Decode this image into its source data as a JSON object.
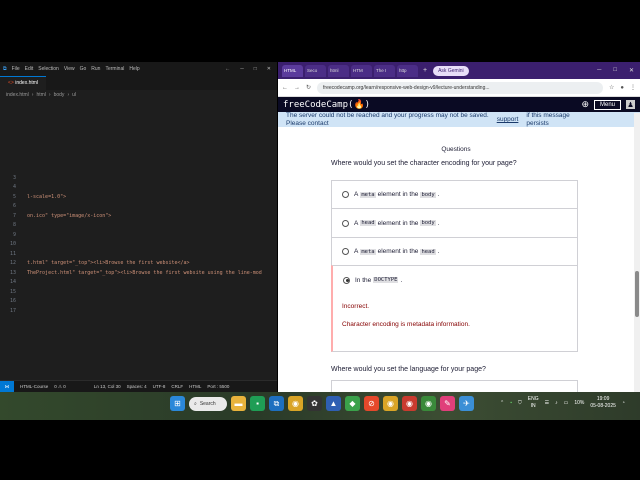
{
  "vscode": {
    "menu": [
      "File",
      "Edit",
      "Selection",
      "View",
      "Go",
      "Run",
      "Terminal",
      "Help"
    ],
    "tab": "index.html",
    "breadcrumb": [
      "index.html",
      "html",
      "body",
      "ul"
    ],
    "lines": [
      {
        "num": "3",
        "code": ""
      },
      {
        "num": "4",
        "code": ""
      },
      {
        "num": "5",
        "code": "l-scale=1.0\">"
      },
      {
        "num": "6",
        "code": ""
      },
      {
        "num": "7",
        "code": "on.ico\" type=\"image/x-icon\">"
      },
      {
        "num": "8",
        "code": ""
      },
      {
        "num": "9",
        "code": ""
      },
      {
        "num": "10",
        "code": ""
      },
      {
        "num": "11",
        "code": ""
      },
      {
        "num": "12",
        "code": "t.html\" target=\"_top\"><li>Browse the first website</a>"
      },
      {
        "num": "13",
        "code": "TheProject.html\" target=\"_top\"><li>Browse the first website using the line-mod"
      },
      {
        "num": "14",
        "code": ""
      },
      {
        "num": "15",
        "code": ""
      },
      {
        "num": "16",
        "code": ""
      },
      {
        "num": "17",
        "code": ""
      }
    ],
    "status": {
      "branch": "HTML-Course",
      "problems": "0 ⚠ 0",
      "position": "Ln 13, Col 30",
      "spaces": "Spaces: 4",
      "encoding": "UTF-8",
      "eol": "CRLF",
      "language": "HTML",
      "port": "Port : 5500"
    }
  },
  "browser": {
    "tabs": [
      "HTML",
      "Seco",
      "html",
      "HTM",
      "The I",
      "http"
    ],
    "gemini": "Ask Gemini",
    "url": "freecodecamp.org/learn/responsive-web-design-v9/lecture-understanding...",
    "site_logo": "freeCodeCamp(🔥)",
    "menu_label": "Menu",
    "banner": {
      "text1": "The server could not be reached and your progress may not be saved.",
      "text2": "Please contact",
      "link": "support",
      "text3": "if this message persists"
    },
    "questions_heading": "Questions",
    "question1": "Where would you set the character encoding for your page?",
    "options": [
      {
        "pre": "A",
        "code1": "meta",
        "mid": "element in the",
        "code2": "body",
        "post": ".",
        "selected": false
      },
      {
        "pre": "A",
        "code1": "head",
        "mid": "element in the",
        "code2": "body",
        "post": ".",
        "selected": false
      },
      {
        "pre": "A",
        "code1": "meta",
        "mid": "element in the",
        "code2": "head",
        "post": ".",
        "selected": false
      },
      {
        "pre": "In the",
        "code1": "DOCTYPE",
        "mid": "",
        "code2": "",
        "post": ".",
        "selected": true
      }
    ],
    "feedback_result": "Incorrect.",
    "feedback_hint": "Character encoding is metadata information.",
    "question2": "Where would you set the language for your page?"
  },
  "taskbar": {
    "search": "Search",
    "lang": "ENG",
    "region": "IN",
    "battery": "10%",
    "time": "19:09",
    "date": "05-08-2025"
  }
}
